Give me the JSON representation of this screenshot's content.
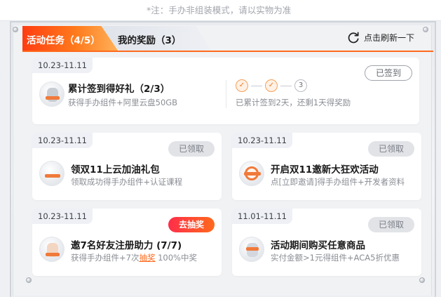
{
  "top_note": "*注：手办非组装模式，请以实物为准",
  "tabs": [
    {
      "label": "活动任务（4/5）",
      "active": true
    },
    {
      "label": "我的奖励（3）",
      "active": false
    }
  ],
  "refresh": {
    "label": "点击刷新一下",
    "icon": "refresh-icon"
  },
  "colors": {
    "accent": "#ff6a1c",
    "hot_start": "#ff2d4a",
    "muted": "#8a8d94"
  },
  "tasks": [
    {
      "date": "10.23-11.11",
      "title": "累计签到得好礼（2/3）",
      "desc": "获得手办组件+阿里云盘50GB",
      "status": "已签到",
      "progress": {
        "done": 2,
        "total": 3,
        "step3_label": "3",
        "text": "已累计签到2天，还剩1天得奖励"
      }
    },
    {
      "date": "10.23-11.11",
      "title": "领双11上云加油礼包",
      "desc": "领取成功得手办组件+认证课程",
      "status": "已领取"
    },
    {
      "date": "10.23-11.11",
      "title": "开启双11邀新大狂欢活动",
      "desc": "点[立即邀请]得手办组件+开发者资料",
      "status": "已领取"
    },
    {
      "date": "10.23-11.11",
      "title": "邀7名好友注册助力 (7/7)",
      "desc_prefix": "获得手办组件+7次",
      "desc_link": "抽奖",
      "desc_suffix": " 100%中奖",
      "status": "去抽奖"
    },
    {
      "date": "11.01-11.11",
      "title": "活动期间购买任意商品",
      "desc": "实付金额>1元得组件+ACA5折优惠",
      "status": "已领取"
    }
  ]
}
